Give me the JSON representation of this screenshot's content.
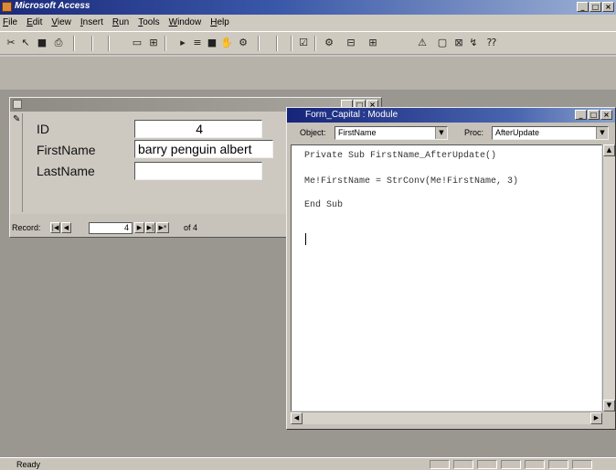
{
  "app": {
    "title": "Microsoft Access",
    "caption_buttons": [
      "_",
      "□",
      "×"
    ]
  },
  "menu": [
    {
      "underline": "F",
      "rest": "ile"
    },
    {
      "underline": "E",
      "rest": "dit"
    },
    {
      "underline": "V",
      "rest": "iew"
    },
    {
      "underline": "I",
      "rest": "nsert"
    },
    {
      "underline": "R",
      "rest": "un"
    },
    {
      "underline": "T",
      "rest": "ools"
    },
    {
      "underline": "W",
      "rest": "indow"
    },
    {
      "underline": "H",
      "rest": "elp"
    }
  ],
  "toolbar_glyphs": [
    "✂",
    "↖",
    "■",
    "⎙",
    "▭",
    "⊞",
    "▸",
    "≡",
    "■",
    "✋",
    "⚙",
    "☑",
    "⚙",
    "⊟",
    "⊞",
    "⚠",
    "▢",
    "⊠",
    "↯",
    "⁇"
  ],
  "form_window": {
    "title": "",
    "caption_buttons": [
      "_",
      "□",
      "×"
    ],
    "fields": [
      {
        "label": "ID",
        "value": "4"
      },
      {
        "label": "FirstName",
        "value": "barry penguin albert"
      },
      {
        "label": "LastName",
        "value": ""
      }
    ],
    "navigation": {
      "label": "Record:",
      "current": "4",
      "of_text": "of 4",
      "btn_first": "|◀",
      "btn_prev": "◀",
      "btn_next": "▶",
      "btn_last": "▶|",
      "btn_new": "▶*"
    }
  },
  "module_window": {
    "title": "Form_Capital : Module",
    "caption_buttons": [
      "_",
      "□",
      "×"
    ],
    "object_label": "Object:",
    "object_value": "FirstName",
    "proc_label": "Proc:",
    "proc_value": "AfterUpdate",
    "code_lines": [
      "Private Sub FirstName_AfterUpdate()",
      "Me!FirstName = StrConv(Me!FirstName, 3)",
      "End Sub"
    ]
  },
  "status": {
    "text": "Ready"
  },
  "colors": {
    "app_title_gradient_start": "#1c2a7a",
    "workspace": "#9a9690",
    "chrome": "#cfcac0"
  }
}
